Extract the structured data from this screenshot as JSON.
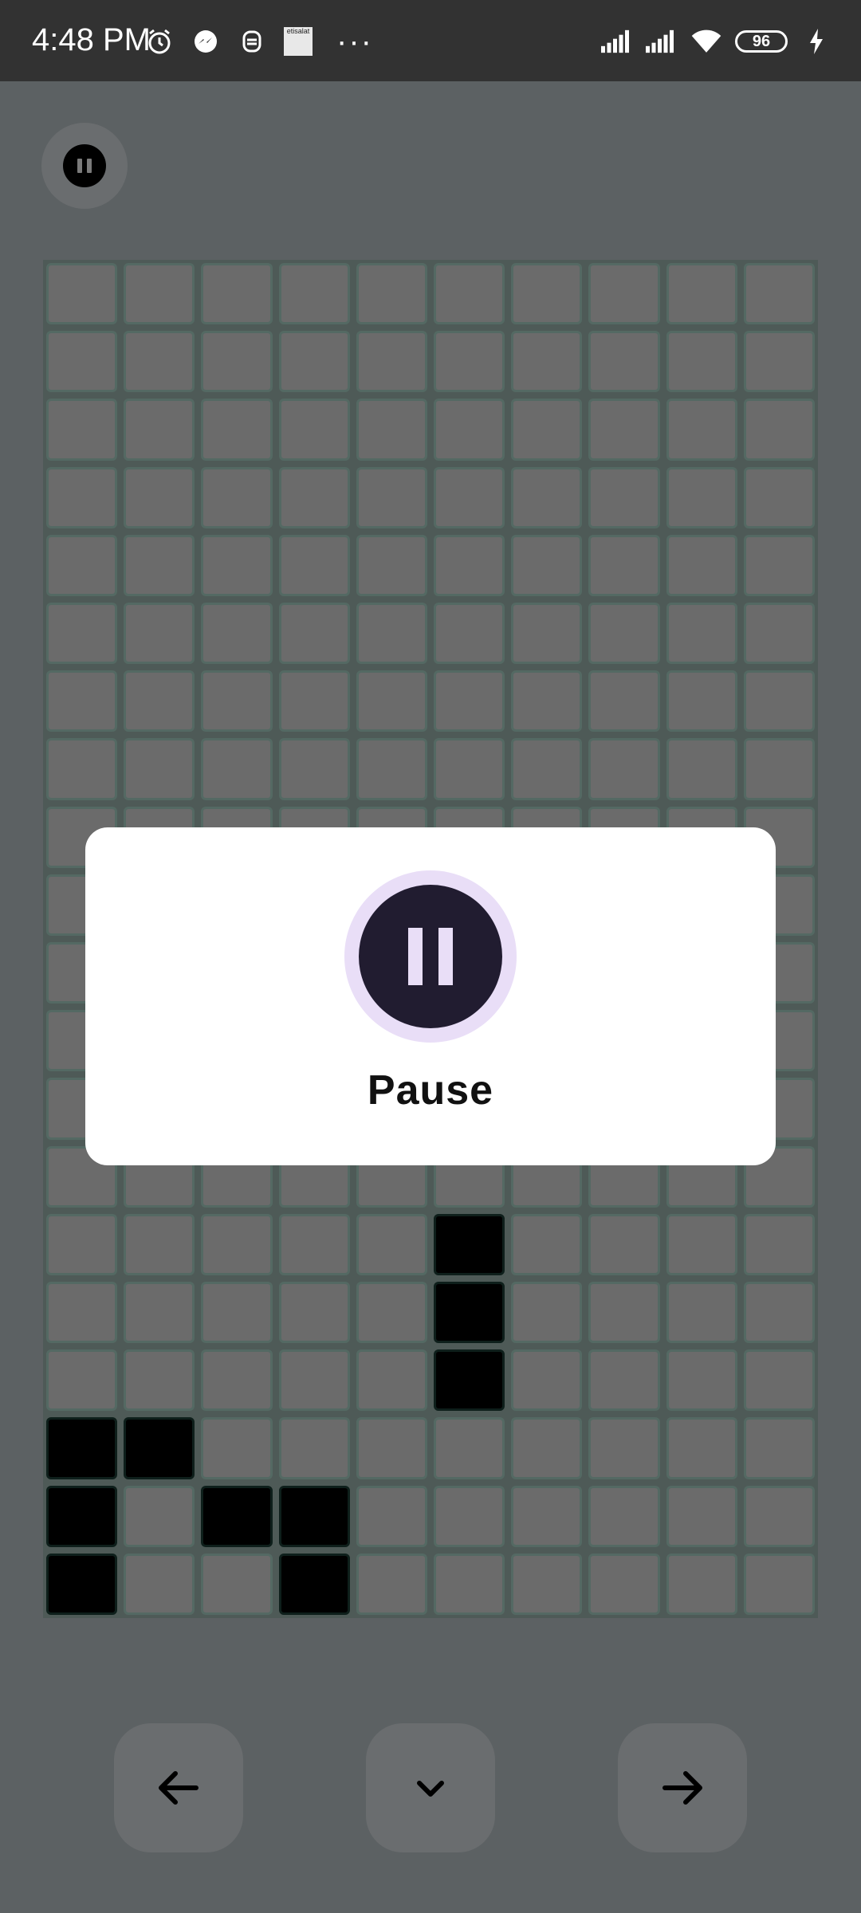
{
  "status_bar": {
    "time": "4:48 PM",
    "carrier_label": "etisalat",
    "battery_level": "96",
    "icons": [
      "alarm-icon",
      "messenger-icon",
      "vpn-icon",
      "carrier-icon",
      "more-dots-icon",
      "signal-icon",
      "signal-icon",
      "wifi-icon",
      "battery-icon",
      "charging-icon"
    ]
  },
  "game": {
    "columns": 10,
    "rows": 20,
    "filled_cells": [
      [
        14,
        5
      ],
      [
        15,
        5
      ],
      [
        16,
        5
      ],
      [
        17,
        0
      ],
      [
        17,
        1
      ],
      [
        18,
        0
      ],
      [
        18,
        2
      ],
      [
        18,
        3
      ],
      [
        19,
        0
      ],
      [
        19,
        3
      ]
    ]
  },
  "dialog": {
    "title": "Pause",
    "icon": "pause-icon"
  },
  "controls": {
    "left": "arrow-left-icon",
    "down": "chevron-down-icon",
    "right": "arrow-right-icon"
  },
  "colors": {
    "background": "#5c6163",
    "cell": "#6b6b6b",
    "cell_border": "#546963",
    "filled": "#000000",
    "dialog_icon_bg": "#211c30",
    "dialog_icon_ring": "#e9def7"
  }
}
